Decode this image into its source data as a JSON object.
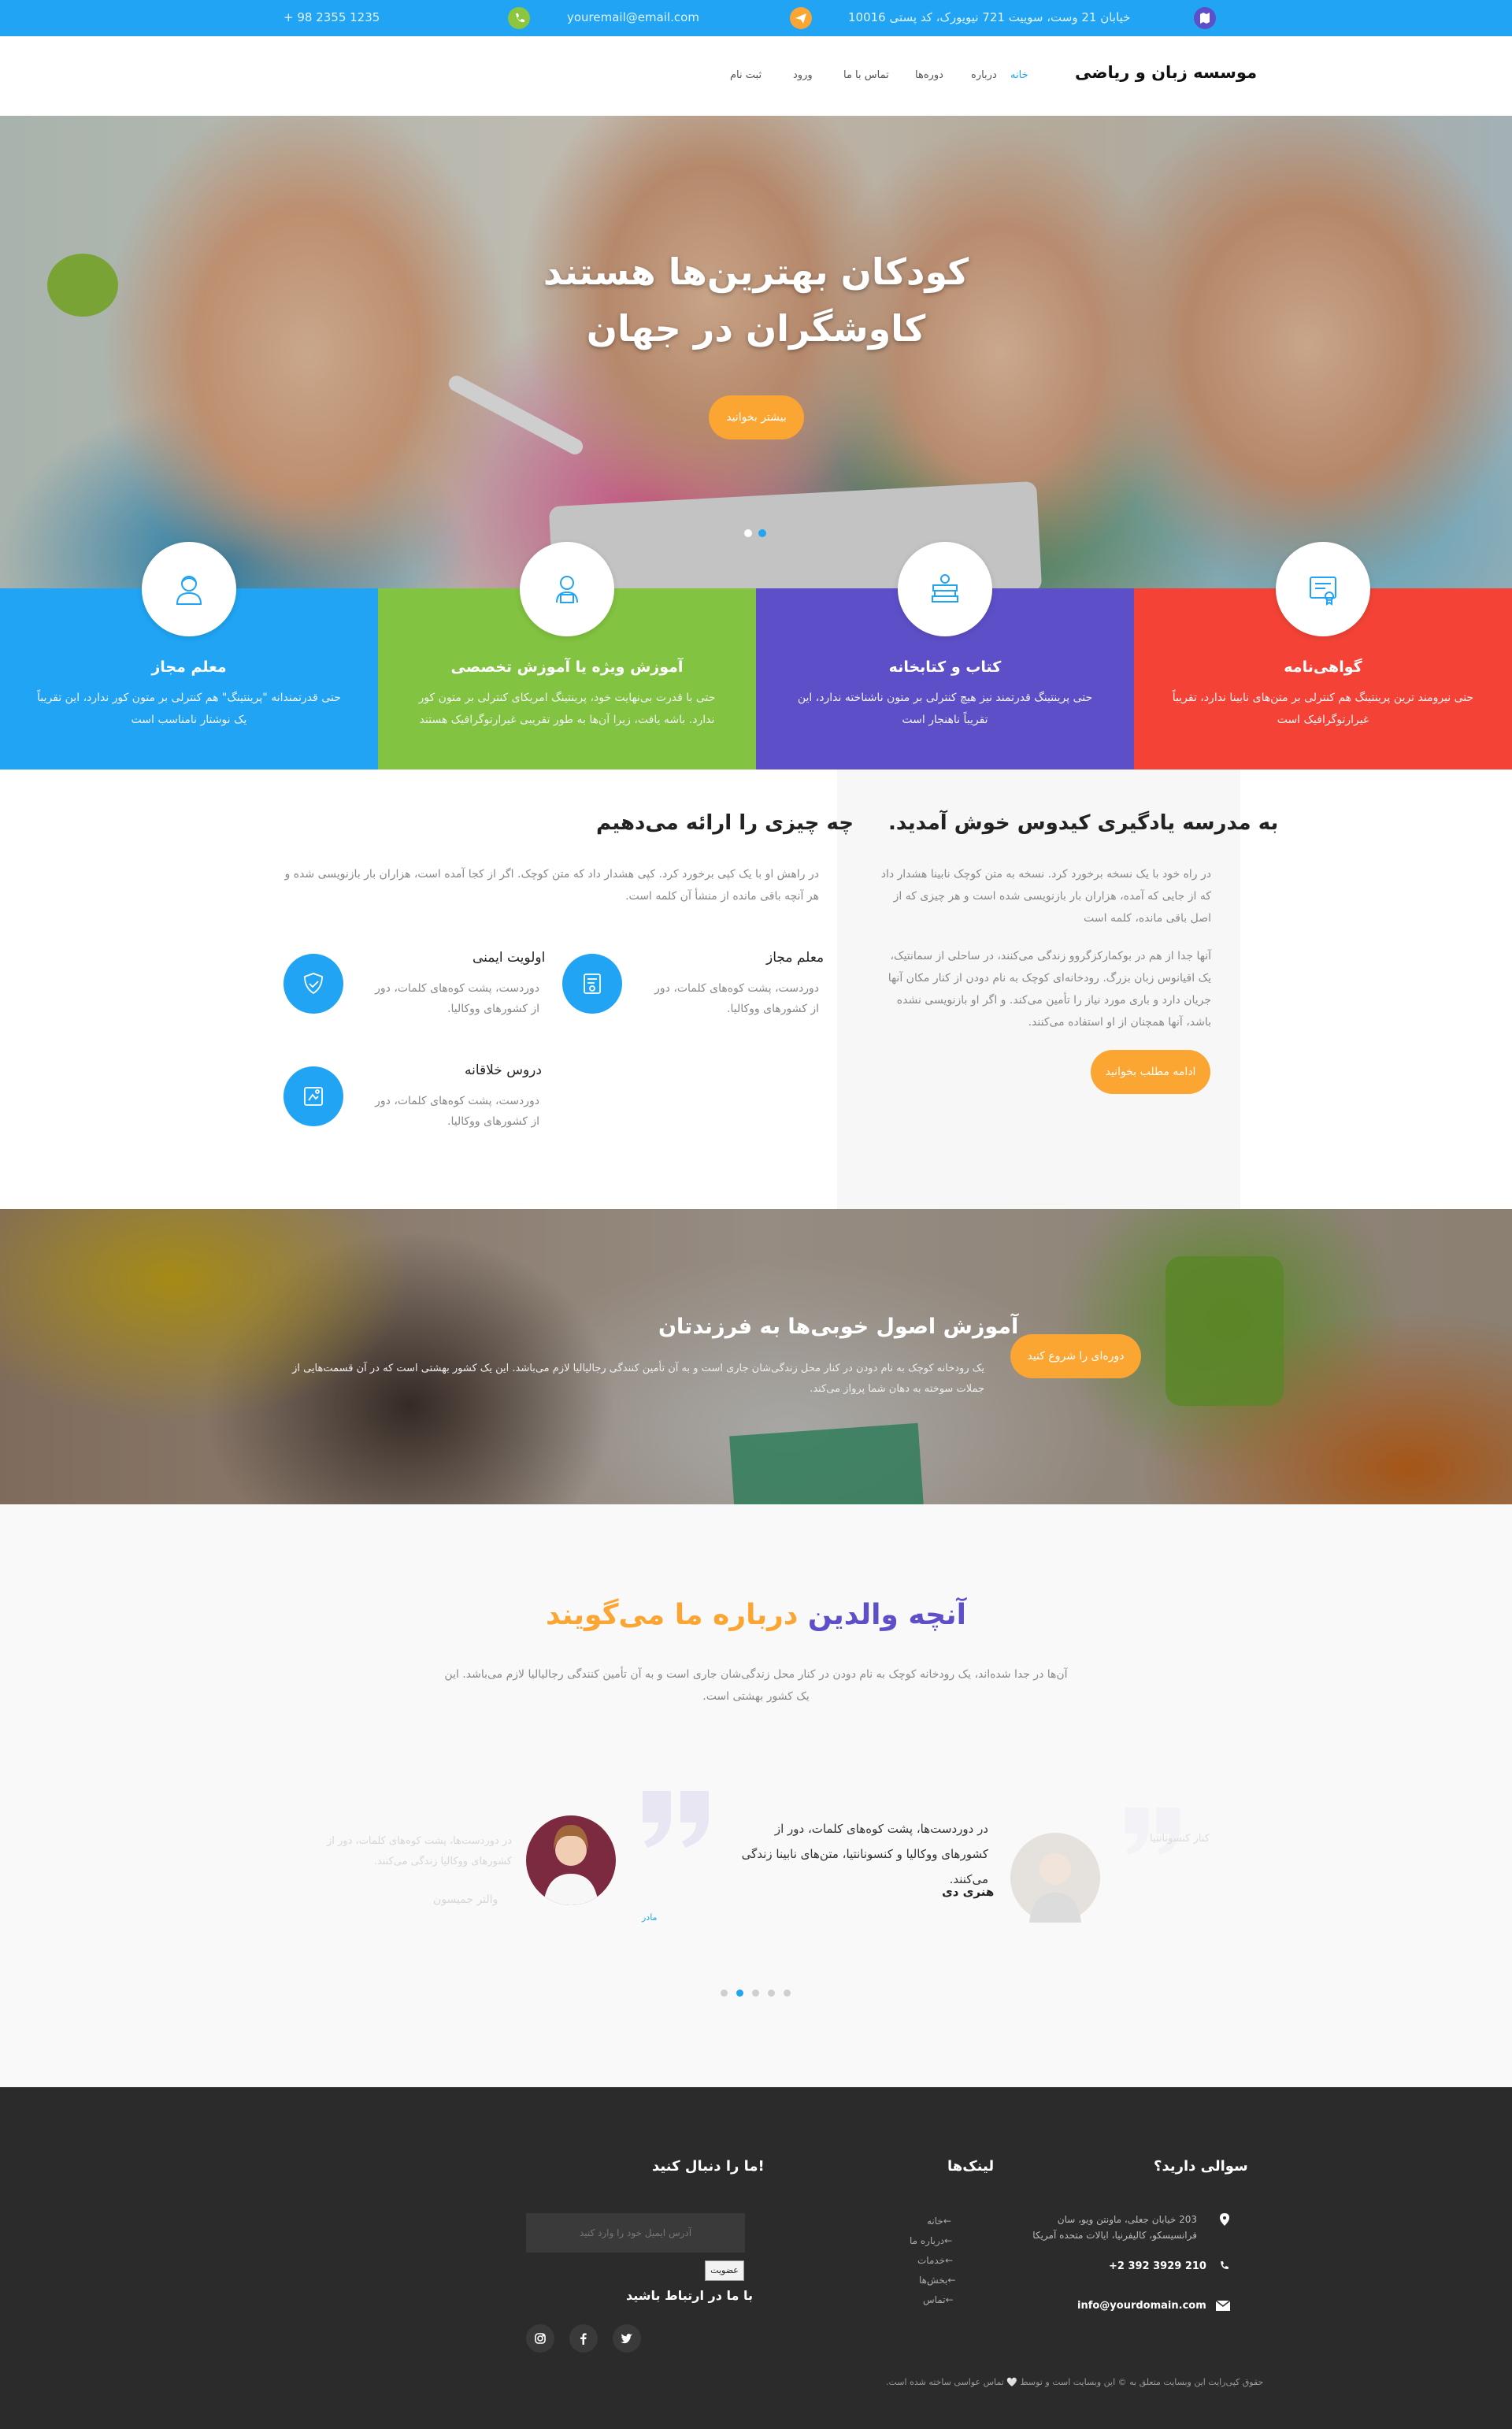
{
  "topbar": {
    "phone": "+ 98 2355 1235",
    "email": "youremail@email.com",
    "address": "خیابان 21 وست، سوییت 721 نیویورک، کد پستی 10016"
  },
  "nav": {
    "brand": "موسسه زبان و ریاضی",
    "items": [
      "خانه",
      "درباره",
      "دوره‌ها",
      "تماس با ما",
      "ورود",
      "ثبت نام"
    ]
  },
  "hero": {
    "title_line1": "کودکان بهترین‌ها هستند",
    "title_line2": "کاوشگران در جهان",
    "button": "بیشتر بخوانید",
    "slides": 2,
    "active_slide": 2
  },
  "features": [
    {
      "title": "معلم مجاز",
      "desc": "حتی قدرتمندانه \"پرینتینگ\" هم کنترلی بر متون کور ندارد، این تقریباً یک نوشتار نامناسب است",
      "color": "#20a4f3",
      "icon": "teacher-icon"
    },
    {
      "title": "آموزش ویژه یا آموزش تخصصی",
      "desc": "حتی با قدرت بی‌نهایت خود، پرینتینگ امریکای کنترلی بر متون کور ندارد. باشه یافت، زیرا آن‌ها به طور تقریبی غیرارتوگرافیک هستند",
      "color": "#82c341",
      "icon": "student-icon"
    },
    {
      "title": "کتاب و کتابخانه",
      "desc": "حتی پرینتینگ قدرتمند نیز هیچ کنترلی بر متون ناشناخته ندارد، این تقریباً ناهنجار است",
      "color": "#5d4fc7",
      "icon": "books-icon"
    },
    {
      "title": "گواهی‌نامه",
      "desc": "حتی نیرومند ترین پرینتینگ هم کنترلی بر متن‌های نابینا ندارد، تقریباً غیرارتوگرافیک است",
      "color": "#f44336",
      "icon": "certificate-icon"
    }
  ],
  "welcome": {
    "title": ".به مدرسه یادگیری کیدوس خوش آمدید",
    "p1": "در راه خود با یک نسخه برخورد کرد. نسخه به متن کوچک نابینا هشدار داد که از جایی که آمده، هزاران بار بازنویسی شده است و هر چیزی که از اصل باقی مانده، کلمه است",
    "p2": "آنها جدا از هم در بوکمارکزگروو زندگی می‌کنند، در ساحلی از سمانتیک، یک اقیانوس زبان بزرگ. رودخانه‌ای کوچک به نام دودن از کنار مکان آنها جریان دارد و باری مورد نیاز را تأمین می‌کند. و اگر او بازنویسی نشده باشد، آنها همچنان از او استفاده می‌کنند.",
    "button": "ادامه مطلب بخوانید"
  },
  "offer": {
    "title": "چه چیزی را ارائه می‌دهیم",
    "desc": "در راهش او با یک کپی برخورد کرد. کپی هشدار داد که متن کوچک. اگر از کجا آمده است، هزاران بار بازنویسی شده و هر آنچه باقی مانده از منشأ آن کلمه است.",
    "items": [
      {
        "title": "معلم مجاز",
        "desc": "دوردست، پشت کوه‌های کلمات، دور از کشورهای ووکالیا.",
        "icon": "certificate-doc-icon"
      },
      {
        "title": "اولویت ایمنی",
        "desc": "دوردست، پشت کوه‌های کلمات، دور از کشورهای ووکالیا.",
        "icon": "shield-icon"
      },
      {
        "title": "دروس خلاقانه",
        "desc": "دوردست، پشت کوه‌های کلمات، دور از کشورهای ووکالیا.",
        "icon": "creative-lesson-icon"
      }
    ]
  },
  "banner": {
    "title": "آموزش اصول خوبی‌ها به فرزندتان",
    "desc": "یک رودخانه کوچک به نام دودن در کنار محل زندگی‌شان جاری است و به آن تأمین کنندگی رجالیالیا لازم می‌باشد. این یک کشور بهشتی است که در آن قسمت‌هایی از جملات سوخته به دهان شما پرواز می‌کند.",
    "button": "دوره‌ای را شروع کنید"
  },
  "testimonials": {
    "title_part1": "آنچه والدین",
    "title_part2": "درباره ما می‌گویند",
    "subtitle": "آن‌ها در جدا شده‌اند، یک رودخانه کوچک به نام دودن در کنار محل زندگی‌شان جاری است و به آن تأمین کنندگی رجالیالیا لازم می‌باشد. این یک کشور بهشتی است.",
    "active_text": "در دوردست‌ها، پشت کوه‌های کلمات، دور از کشورهای ووکالیا و کنسونانتیا، متن‌های نابینا زندگی می‌کنند.",
    "active_name": "هنری دی",
    "active_role": "مادر",
    "side_left_text": "در دوردست‌ها، پشت کوه‌های کلمات، دور از کشورهای ووکالیا زندگی می‌کنند.",
    "side_left_name": "والتر جمیسون",
    "side_right_text": "کنار کنسونانتیا",
    "dots": 5,
    "active_dot": 2,
    "accent_purple": "#5d4fc7",
    "accent_orange": "#fba533"
  },
  "footer": {
    "contact_title": "سوالی دارید؟",
    "address": "203 خیابان جعلی، ماونتن ویو، سان فرانسیسکو، کالیفرنیا، ایالات متحده آمریکا",
    "phone": "+2 392 3929 210",
    "email": "info@yourdomain.com",
    "links_title": "لینک‌ها",
    "links": [
      "خانه←",
      "درباره ما←",
      "خدمات←",
      "بخش‌ها←",
      "تماس←"
    ],
    "follow_title": "ما را دنبال کنید!",
    "email_placeholder": "آدرس ایمیل خود را وارد کنید",
    "subscribe": "عضویت",
    "connect_title": "با ما در ارتباط باشید",
    "copyright": "حقوق کپی‌رایت این وبسایت متعلق به © این وبسایت است و توسط 🤍 تماس عواسی ساخته شده است."
  }
}
